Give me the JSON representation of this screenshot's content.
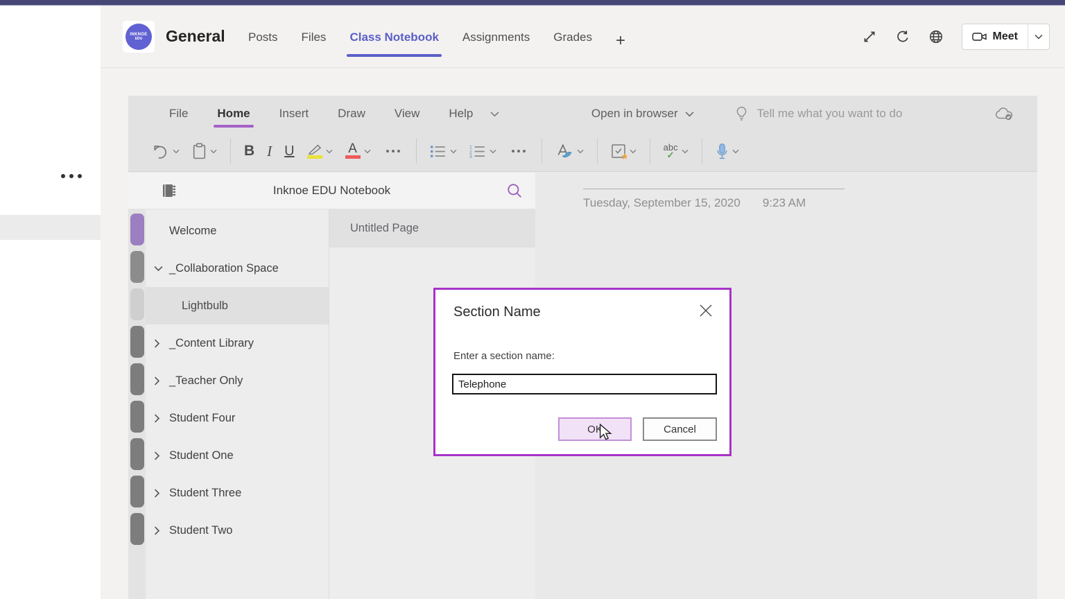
{
  "colors": {
    "teams_top_bar": "#464775",
    "active_tab_purple": "#5b5fc7",
    "onenote_accent_purple": "#a661c8",
    "dialog_border": "#a832c8",
    "ok_button_bg": "#f2e2f7",
    "highlight_yellow": "#e7e23a",
    "font_color_red": "#ef5a5a",
    "welcome_tab_marker": "#9b7fc0",
    "section_tab_marker": "#7d7d7d"
  },
  "left_rail": {
    "more_icon": "more-options-icon"
  },
  "header": {
    "avatar_line1": "INKNOE",
    "avatar_line2": "EDU",
    "title": "General",
    "tabs": [
      {
        "label": "Posts",
        "active": false
      },
      {
        "label": "Files",
        "active": false
      },
      {
        "label": "Class Notebook",
        "active": true
      },
      {
        "label": "Assignments",
        "active": false
      },
      {
        "label": "Grades",
        "active": false
      }
    ],
    "add_tab_label": "+",
    "icons": [
      "expand-icon",
      "refresh-icon",
      "globe-icon"
    ],
    "meet": {
      "label": "Meet",
      "icon": "video-camera-icon"
    }
  },
  "ribbon": {
    "menus": [
      {
        "label": "File",
        "active": false
      },
      {
        "label": "Home",
        "active": true
      },
      {
        "label": "Insert",
        "active": false
      },
      {
        "label": "Draw",
        "active": false
      },
      {
        "label": "View",
        "active": false
      },
      {
        "label": "Help",
        "active": false
      }
    ],
    "open_in_browser_label": "Open in browser",
    "tell_me_text": "Tell me what you want to do",
    "sync_icon": "cloud-synced-icon"
  },
  "toolbar": {
    "bold_label": "B",
    "italic_label": "I",
    "underline_label": "U",
    "font_color_label": "A",
    "spelling_label": "abc",
    "icons": [
      "undo-icon",
      "paste-icon",
      "highlighter-icon",
      "bullet-list-icon",
      "numbered-list-icon",
      "styles-icon",
      "tag-icon",
      "spelling-icon",
      "dictate-icon"
    ]
  },
  "notebook": {
    "title": "Inknoe EDU Notebook",
    "sections": [
      {
        "label": "Welcome",
        "chevron": "none",
        "selected": false
      },
      {
        "label": "_Collaboration Space",
        "chevron": "down",
        "selected": false
      },
      {
        "label": "Lightbulb",
        "chevron": "none",
        "selected": true
      },
      {
        "label": "_Content Library",
        "chevron": "right",
        "selected": false
      },
      {
        "label": "_Teacher Only",
        "chevron": "right",
        "selected": false
      },
      {
        "label": "Student Four",
        "chevron": "right",
        "selected": false
      },
      {
        "label": "Student One",
        "chevron": "right",
        "selected": false
      },
      {
        "label": "Student Three",
        "chevron": "right",
        "selected": false
      },
      {
        "label": "Student Two",
        "chevron": "right",
        "selected": false
      }
    ],
    "pages": [
      {
        "label": "Untitled Page",
        "selected": true
      }
    ]
  },
  "page": {
    "date": "Tuesday, September 15, 2020",
    "time": "9:23 AM"
  },
  "dialog": {
    "title": "Section Name",
    "label": "Enter a section name:",
    "input_value": "Telephone",
    "ok_label": "OK",
    "cancel_label": "Cancel"
  }
}
